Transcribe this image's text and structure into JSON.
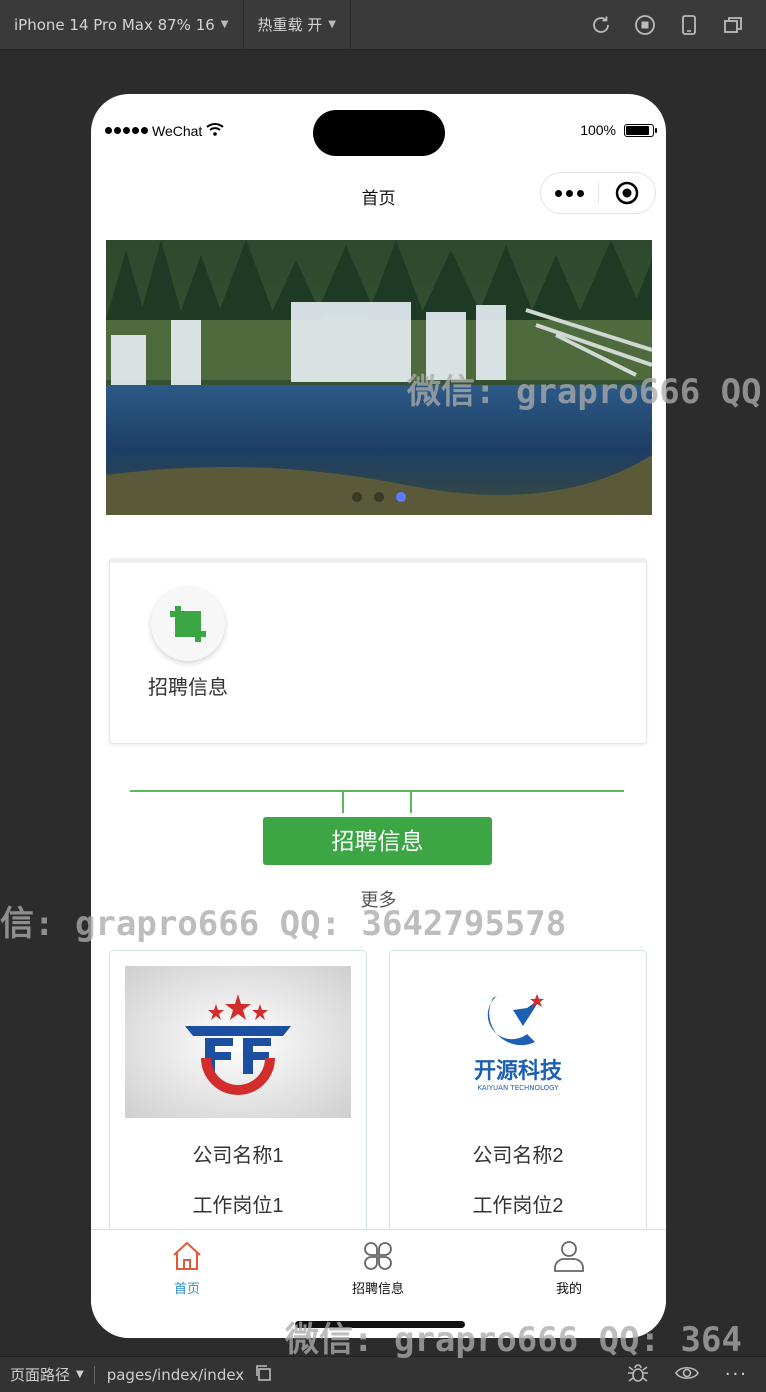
{
  "devtools": {
    "device": "iPhone 14 Pro Max 87% 16",
    "hot_reload": "热重载 开",
    "bottom": {
      "path_label": "页面路径",
      "path_value": "pages/index/index"
    }
  },
  "status_bar": {
    "carrier": "WeChat",
    "battery": "100%"
  },
  "nav": {
    "title": "首页"
  },
  "banner": {
    "slide_count": 3,
    "active_slide": 3
  },
  "menu": {
    "items": [
      {
        "label": "招聘信息",
        "icon": "crop-icon"
      }
    ]
  },
  "section": {
    "title": "招聘信息",
    "more": "更多"
  },
  "jobs": [
    {
      "company": "公司名称1",
      "position": "工作岗位1"
    },
    {
      "company": "公司名称2",
      "position": "工作岗位2",
      "logo_text": "开源科技",
      "logo_sub": "KAIYUAN TECHNOLOGY"
    }
  ],
  "tabbar": {
    "items": [
      {
        "label": "首页",
        "icon": "home-icon",
        "active": true
      },
      {
        "label": "招聘信息",
        "icon": "four-petal-icon",
        "active": false
      },
      {
        "label": "我的",
        "icon": "user-icon",
        "active": false
      }
    ]
  },
  "watermarks": [
    "微信: grapro666 QQ",
    "信: grapro666 QQ: 3642795578",
    "微信: grapro666 QQ: 364"
  ],
  "colors": {
    "accent_green": "#3ca644",
    "tab_active": "#2a8fd0",
    "home_icon": "#e05a3a"
  }
}
